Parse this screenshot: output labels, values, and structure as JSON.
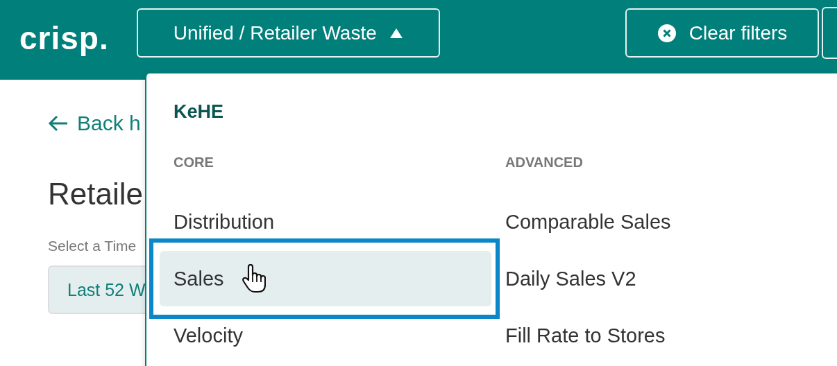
{
  "header": {
    "logo": "crisp.",
    "report_selector": {
      "label": "Unified / Retailer Waste",
      "expanded": true
    },
    "clear_filters": "Clear filters"
  },
  "page": {
    "back_link": "Back h",
    "title": "Retaile",
    "time_label": "Select a Time",
    "time_button": "Last 52 W"
  },
  "menu": {
    "title": "KeHE",
    "columns": [
      {
        "heading": "CORE",
        "items": [
          {
            "label": "Distribution",
            "selected": false,
            "outlined": false
          },
          {
            "label": "Sales",
            "selected": true,
            "outlined": true
          },
          {
            "label": "Velocity",
            "selected": false,
            "outlined": false
          }
        ]
      },
      {
        "heading": "ADVANCED",
        "items": [
          {
            "label": "Comparable Sales",
            "selected": false,
            "outlined": false
          },
          {
            "label": "Daily Sales V2",
            "selected": false,
            "outlined": false
          },
          {
            "label": "Fill Rate to Stores",
            "selected": false,
            "outlined": false
          }
        ]
      }
    ]
  }
}
